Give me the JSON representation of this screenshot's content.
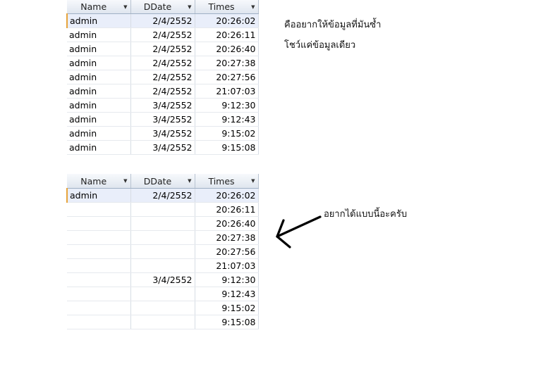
{
  "table1": {
    "headers": [
      "Name",
      "DDate",
      "Times"
    ],
    "rows": [
      {
        "name": "admin",
        "ddate": "2/4/2552",
        "times": "20:26:02"
      },
      {
        "name": "admin",
        "ddate": "2/4/2552",
        "times": "20:26:11"
      },
      {
        "name": "admin",
        "ddate": "2/4/2552",
        "times": "20:26:40"
      },
      {
        "name": "admin",
        "ddate": "2/4/2552",
        "times": "20:27:38"
      },
      {
        "name": "admin",
        "ddate": "2/4/2552",
        "times": "20:27:56"
      },
      {
        "name": "admin",
        "ddate": "2/4/2552",
        "times": "21:07:03"
      },
      {
        "name": "admin",
        "ddate": "3/4/2552",
        "times": "9:12:30"
      },
      {
        "name": "admin",
        "ddate": "3/4/2552",
        "times": "9:12:43"
      },
      {
        "name": "admin",
        "ddate": "3/4/2552",
        "times": "9:15:02"
      },
      {
        "name": "admin",
        "ddate": "3/4/2552",
        "times": "9:15:08"
      }
    ]
  },
  "table2": {
    "headers": [
      "Name",
      "DDate",
      "Times"
    ],
    "rows": [
      {
        "name": "admin",
        "ddate": "2/4/2552",
        "times": "20:26:02"
      },
      {
        "name": "",
        "ddate": "",
        "times": "20:26:11"
      },
      {
        "name": "",
        "ddate": "",
        "times": "20:26:40"
      },
      {
        "name": "",
        "ddate": "",
        "times": "20:27:38"
      },
      {
        "name": "",
        "ddate": "",
        "times": "20:27:56"
      },
      {
        "name": "",
        "ddate": "",
        "times": "21:07:03"
      },
      {
        "name": "",
        "ddate": "3/4/2552",
        "times": "9:12:30"
      },
      {
        "name": "",
        "ddate": "",
        "times": "9:12:43"
      },
      {
        "name": "",
        "ddate": "",
        "times": "9:15:02"
      },
      {
        "name": "",
        "ddate": "",
        "times": "9:15:08"
      }
    ]
  },
  "notes": {
    "line1": "คืออยากให้ข้อมูลที่มันซ้ำ",
    "line2": "โชว์แค่ข้อมูลเดียว",
    "arrow_label": "อยากได้แบบนี้อะครับ"
  },
  "icons": {
    "header_caret": "dropdown-caret-icon",
    "arrow": "arrow-icon"
  }
}
